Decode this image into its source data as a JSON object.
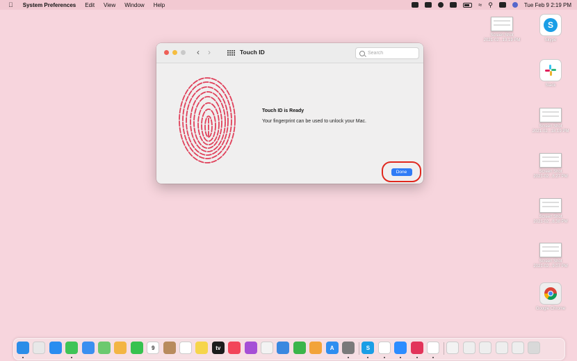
{
  "menubar": {
    "app_name": "System Preferences",
    "menus": [
      "Edit",
      "View",
      "Window",
      "Help"
    ],
    "clock": "Tue Feb 9  2:19 PM"
  },
  "window": {
    "title": "Touch ID",
    "search_placeholder": "Search",
    "message_title": "Touch ID is Ready",
    "message_body": "Your fingerprint can be used to unlock your Mac.",
    "done_label": "Done"
  },
  "desktop": {
    "items": [
      {
        "label": "Screen Shot\n2021-02...19.19 PM",
        "kind": "screenshot"
      },
      {
        "label": "Skype",
        "kind": "skype"
      },
      {
        "label": "Slack",
        "kind": "slack"
      },
      {
        "label": "Screen Shot\n2021-02...18.19 PM",
        "kind": "screenshot"
      },
      {
        "label": "Screen Shot\n2021-02...8.27 PM",
        "kind": "screenshot"
      },
      {
        "label": "Screen Shot\n2021-02...8.38 PM",
        "kind": "screenshot"
      },
      {
        "label": "Screen Shot\n2021-02...9.07 PM",
        "kind": "screenshot"
      },
      {
        "label": "Google Chrome",
        "kind": "chrome"
      }
    ]
  },
  "dock": {
    "apps": [
      {
        "name": "finder-icon",
        "color": "#2b8de8",
        "glyph": ""
      },
      {
        "name": "launchpad-icon",
        "color": "#e8e8e8",
        "glyph": ""
      },
      {
        "name": "safari-icon",
        "color": "#2a8df0",
        "glyph": ""
      },
      {
        "name": "messages-icon",
        "color": "#3fc457",
        "glyph": ""
      },
      {
        "name": "mail-icon",
        "color": "#3b8ff0",
        "glyph": ""
      },
      {
        "name": "maps-icon",
        "color": "#6cc96e",
        "glyph": ""
      },
      {
        "name": "photos-icon",
        "color": "#f3b544",
        "glyph": ""
      },
      {
        "name": "facetime-icon",
        "color": "#37c24f",
        "glyph": ""
      },
      {
        "name": "calendar-icon",
        "color": "#ffffff",
        "glyph": "9"
      },
      {
        "name": "contacts-icon",
        "color": "#b88b5e",
        "glyph": ""
      },
      {
        "name": "reminders-icon",
        "color": "#ffffff",
        "glyph": ""
      },
      {
        "name": "notes-icon",
        "color": "#f6d54b",
        "glyph": ""
      },
      {
        "name": "tv-icon",
        "color": "#1c1c1c",
        "glyph": "tv"
      },
      {
        "name": "music-icon",
        "color": "#f2455a",
        "glyph": ""
      },
      {
        "name": "podcasts-icon",
        "color": "#a64fd6",
        "glyph": ""
      },
      {
        "name": "news-icon",
        "color": "#f3f3f3",
        "glyph": ""
      },
      {
        "name": "keynote-icon",
        "color": "#3a88e0",
        "glyph": ""
      },
      {
        "name": "numbers-icon",
        "color": "#3bb54a",
        "glyph": ""
      },
      {
        "name": "pages-icon",
        "color": "#f2a33a",
        "glyph": ""
      },
      {
        "name": "app-store-icon",
        "color": "#2f8ef0",
        "glyph": "A"
      },
      {
        "name": "system-preferences-icon",
        "color": "#7a7a7a",
        "glyph": ""
      },
      {
        "name": "skype-icon",
        "color": "#1a9ee6",
        "glyph": "S"
      },
      {
        "name": "slack-icon",
        "color": "#ffffff",
        "glyph": ""
      },
      {
        "name": "zoom-icon",
        "color": "#2d8cff",
        "glyph": ""
      },
      {
        "name": "airmail-icon",
        "color": "#e2345a",
        "glyph": ""
      },
      {
        "name": "chrome-icon",
        "color": "#ffffff",
        "glyph": ""
      },
      {
        "name": "document-icon",
        "color": "#f3f3f3",
        "glyph": ""
      },
      {
        "name": "screenshot-stack-icon",
        "color": "#eeeeee",
        "glyph": ""
      },
      {
        "name": "screenshot-stack-icon",
        "color": "#eeeeee",
        "glyph": ""
      },
      {
        "name": "screenshot-stack-icon",
        "color": "#eeeeee",
        "glyph": ""
      },
      {
        "name": "screenshot-stack-icon",
        "color": "#eeeeee",
        "glyph": ""
      },
      {
        "name": "trash-icon",
        "color": "#d9d9d9",
        "glyph": ""
      }
    ]
  }
}
